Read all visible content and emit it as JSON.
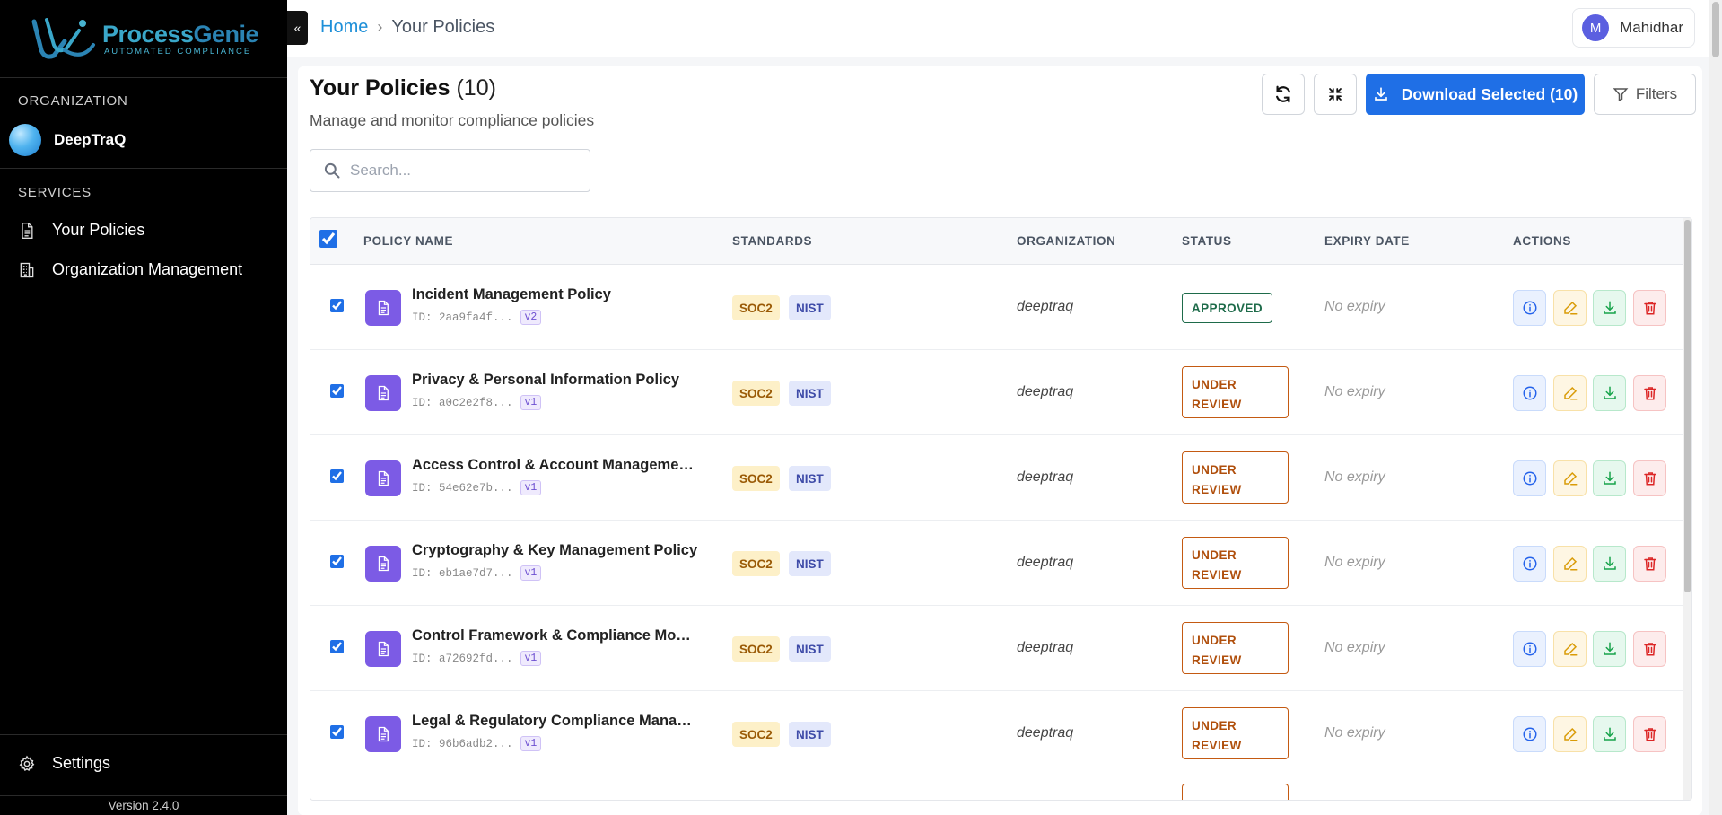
{
  "brand": {
    "name_a": "Process",
    "name_b": "Genie",
    "tagline": "AUTOMATED COMPLIANCE"
  },
  "sidebar": {
    "org_section": "ORGANIZATION",
    "org_name": "DeepTraQ",
    "services_section": "SERVICES",
    "items": [
      {
        "label": "Your Policies",
        "icon": "document-icon"
      },
      {
        "label": "Organization Management",
        "icon": "building-icon"
      }
    ],
    "settings_label": "Settings",
    "version": "Version 2.4.0"
  },
  "topbar": {
    "collapse_glyph": "«",
    "breadcrumb": {
      "home": "Home",
      "separator": "›",
      "current": "Your Policies"
    },
    "user": {
      "initial": "M",
      "name": "Mahidhar"
    }
  },
  "page": {
    "title": "Your Policies",
    "count": "(10)",
    "subtitle": "Manage and monitor compliance policies",
    "search_placeholder": "Search...",
    "download_label": "Download Selected (10)",
    "filters_label": "Filters"
  },
  "table": {
    "headers": [
      "POLICY NAME",
      "STANDARDS",
      "ORGANIZATION",
      "STATUS",
      "EXPIRY DATE",
      "ACTIONS"
    ],
    "rows": [
      {
        "name": "Incident Management Policy",
        "id": "ID: 2aa9fa4f...",
        "version": "v2",
        "standards": [
          "SOC2",
          "NIST"
        ],
        "org": "deeptraq",
        "status": "APPROVED",
        "status_l1": "APPROVED",
        "status_l2": "",
        "expiry": "No expiry"
      },
      {
        "name": "Privacy & Personal Information Policy",
        "id": "ID: a0c2e2f8...",
        "version": "v1",
        "standards": [
          "SOC2",
          "NIST"
        ],
        "org": "deeptraq",
        "status": "UNDER REVIEW",
        "status_l1": "UNDER",
        "status_l2": "REVIEW",
        "expiry": "No expiry"
      },
      {
        "name": "Access Control & Account Management...",
        "id": "ID: 54e62e7b...",
        "version": "v1",
        "standards": [
          "SOC2",
          "NIST"
        ],
        "org": "deeptraq",
        "status": "UNDER REVIEW",
        "status_l1": "UNDER",
        "status_l2": "REVIEW",
        "expiry": "No expiry"
      },
      {
        "name": "Cryptography & Key Management Policy",
        "id": "ID: eb1ae7d7...",
        "version": "v1",
        "standards": [
          "SOC2",
          "NIST"
        ],
        "org": "deeptraq",
        "status": "UNDER REVIEW",
        "status_l1": "UNDER",
        "status_l2": "REVIEW",
        "expiry": "No expiry"
      },
      {
        "name": "Control Framework & Compliance Monit...",
        "id": "ID: a72692fd...",
        "version": "v1",
        "standards": [
          "SOC2",
          "NIST"
        ],
        "org": "deeptraq",
        "status": "UNDER REVIEW",
        "status_l1": "UNDER",
        "status_l2": "REVIEW",
        "expiry": "No expiry"
      },
      {
        "name": "Legal & Regulatory Compliance Manage...",
        "id": "ID: 96b6adb2...",
        "version": "v1",
        "standards": [
          "SOC2",
          "NIST"
        ],
        "org": "deeptraq",
        "status": "UNDER REVIEW",
        "status_l1": "UNDER",
        "status_l2": "REVIEW",
        "expiry": "No expiry"
      }
    ]
  },
  "colors": {
    "accent": "#1f6fe6",
    "doc_icon": "#7c5be5",
    "approved": "#1e6b4a",
    "under_review": "#c45a12"
  }
}
